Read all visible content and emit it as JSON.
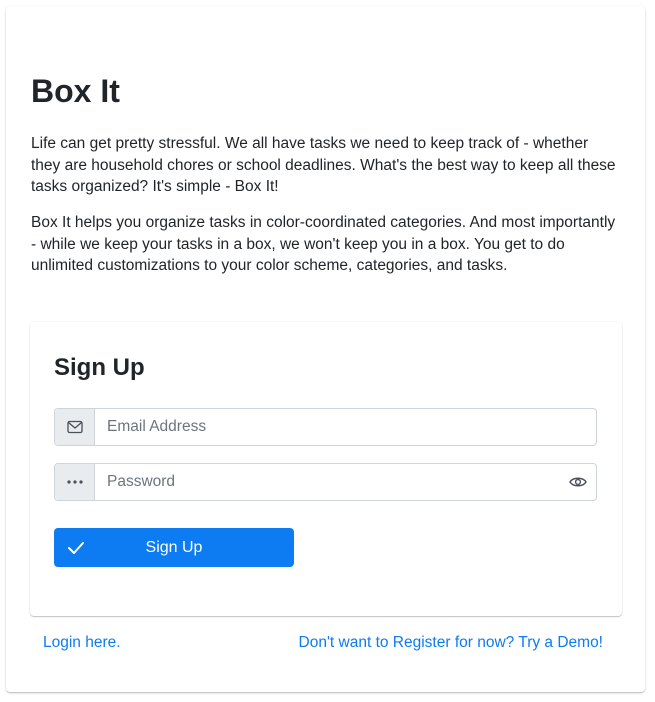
{
  "app": {
    "title": "Box It",
    "intro_paragraphs": [
      "Life can get pretty stressful. We all have tasks we need to keep track of - whether they are household chores or school deadlines. What's the best way to keep all these tasks organized? It's simple - Box It!",
      "Box It helps you organize tasks in color-coordinated categories. And most importantly - while we keep your tasks in a box, we won't keep you in a box. You get to do unlimited customizations to your color scheme, categories, and tasks."
    ]
  },
  "signup": {
    "title": "Sign Up",
    "email": {
      "placeholder": "Email Address",
      "value": "",
      "icon": "envelope-icon"
    },
    "password": {
      "placeholder": "Password",
      "value": "",
      "icon": "dots-icon",
      "toggle_icon": "eye-icon"
    },
    "button": {
      "label": "Sign Up",
      "icon": "check-icon"
    }
  },
  "footer": {
    "login_link": "Login here.",
    "demo_link": "Don't want to Register for now? Try a Demo!"
  },
  "colors": {
    "accent": "#0d7bf2",
    "addon_bg": "#e9ecef",
    "border": "#ced4da",
    "text": "#212529"
  }
}
